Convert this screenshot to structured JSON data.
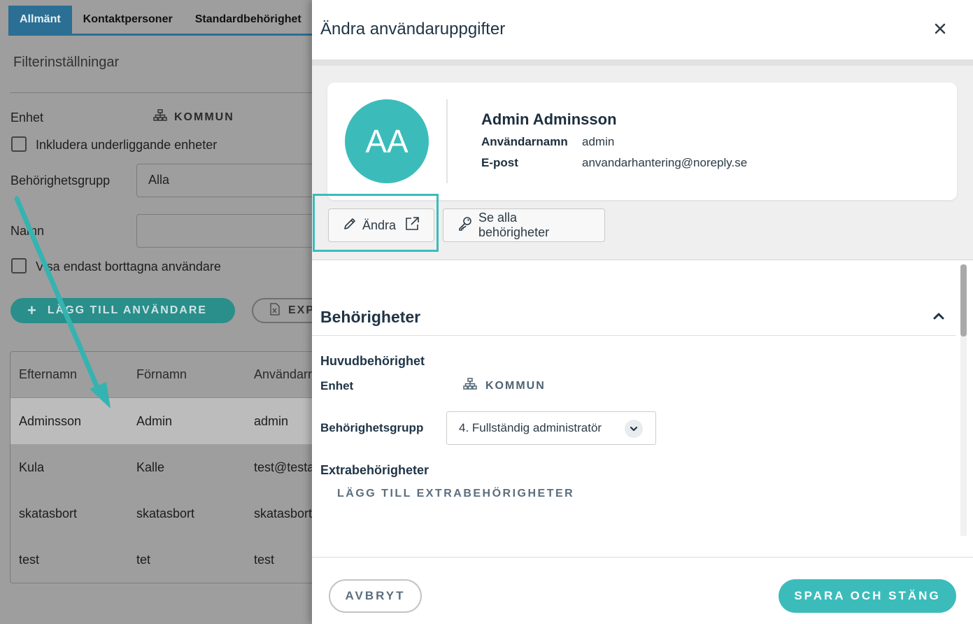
{
  "colors": {
    "accent": "#3bbcbb",
    "tab_active": "#2b6f95",
    "title_text": "#1f3446"
  },
  "background": {
    "tabs": [
      "Allmänt",
      "Kontaktpersoner",
      "Standardbehörighet"
    ],
    "filter_title": "Filterinställningar",
    "unit_label": "Enhet",
    "unit_value": "KOMMUN",
    "include_sub_units_label": "Inkludera underliggande enheter",
    "group_label": "Behörighetsgrupp",
    "group_value": "Alla",
    "name_label": "Namn",
    "show_deleted_label": "Visa endast borttagna användare",
    "add_user_label": "LÄGG TILL ANVÄNDARE",
    "export_label": "EXP",
    "table": {
      "columns": [
        "Efternamn",
        "Förnamn",
        "Användarnamn"
      ],
      "rows": [
        [
          "Adminsson",
          "Admin",
          "admin"
        ],
        [
          "Kula",
          "Kalle",
          "test@testa"
        ],
        [
          "skatasbort",
          "skatasbort",
          "skatasbort"
        ],
        [
          "test",
          "tet",
          "test"
        ]
      ]
    }
  },
  "modal": {
    "title": "Ändra användaruppgifter",
    "close_icon": "close-icon",
    "user": {
      "initials": "AA",
      "full_name": "Admin Adminsson",
      "username_label": "Användarnamn",
      "username": "admin",
      "email_label": "E-post",
      "email": "anvandarhantering@noreply.se"
    },
    "edit_button_label": "Ändra",
    "view_permissions_label": "Se alla behörigheter",
    "permissions": {
      "title": "Behörigheter",
      "main_title": "Huvudbehörighet",
      "unit_label": "Enhet",
      "unit_value": "KOMMUN",
      "group_label": "Behörighetsgrupp",
      "group_value": "4. Fullständig administratör",
      "extra_title": "Extrabehörigheter",
      "add_extra_label": "LÄGG TILL EXTRABEHÖRIGHETER"
    },
    "cancel_label": "AVBRYT",
    "save_label": "SPARA OCH STÄNG"
  }
}
